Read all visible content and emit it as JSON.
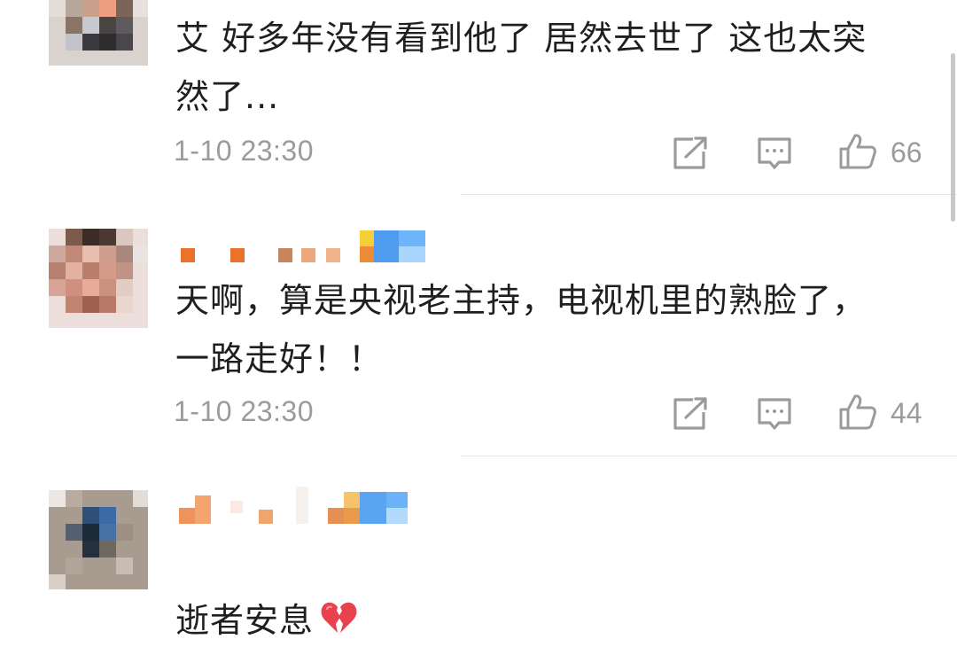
{
  "comments": [
    {
      "text": "艾 好多年没有看到他了 居然去世了 这也太突\n然了...",
      "time": "1-10 23:30",
      "likes": "66"
    },
    {
      "text": "天啊，算是央视老主持，电视机里的熟脸了，\n一路走好！！",
      "time": "1-10 23:30",
      "likes": "44"
    },
    {
      "text": "逝者安息",
      "time": "",
      "likes": ""
    }
  ],
  "icons": {
    "repost": "repost-icon",
    "reply": "comment-icon",
    "like": "thumbs-up-icon",
    "emoji": "broken-heart-icon"
  },
  "colors": {
    "text": "#1f1f1f",
    "meta": "#9b9b9b",
    "divider": "#e8e8e8",
    "heart": "#e8424f"
  }
}
